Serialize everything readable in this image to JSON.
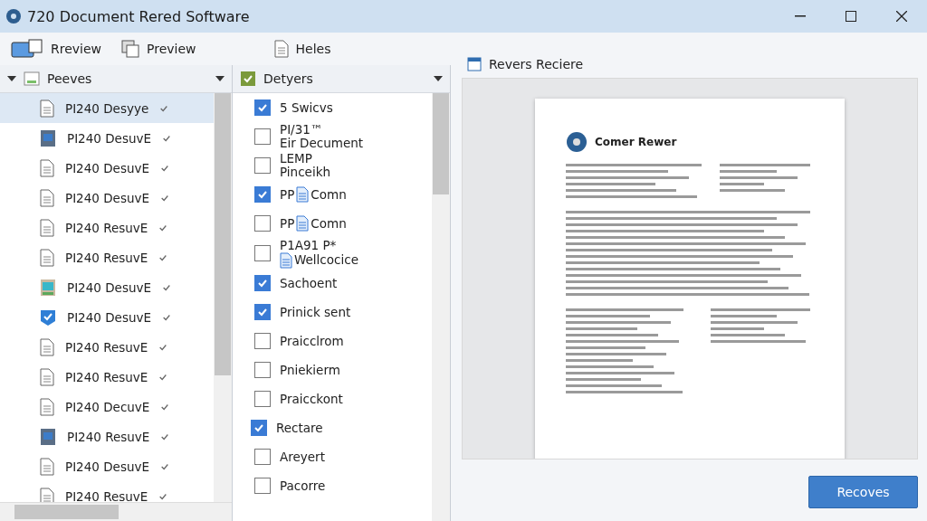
{
  "window": {
    "title": "720 Document Rered Software"
  },
  "toolbar": [
    {
      "label": "Rreview",
      "kind": "scanner"
    },
    {
      "label": "Preview",
      "kind": "windows"
    },
    {
      "label": "Heles",
      "kind": "document"
    }
  ],
  "files_panel": {
    "title": "Peeves",
    "items": [
      {
        "label": "PI240 Desyye",
        "kind": "document",
        "selected": true
      },
      {
        "label": "PI240 DesuvE",
        "kind": "app",
        "selected": false
      },
      {
        "label": "PI240 DesuvE",
        "kind": "document",
        "selected": false
      },
      {
        "label": "PI240 DesuvE",
        "kind": "document",
        "selected": false
      },
      {
        "label": "PI240 ResuvE",
        "kind": "document",
        "selected": false
      },
      {
        "label": "PI240 ResuvE",
        "kind": "document",
        "selected": false
      },
      {
        "label": "PI240 DesuvE",
        "kind": "image",
        "selected": false
      },
      {
        "label": "PI240 DesuvE",
        "kind": "check",
        "selected": false
      },
      {
        "label": "PI240 ResuvE",
        "kind": "document",
        "selected": false
      },
      {
        "label": "PI240 ResuvE",
        "kind": "document",
        "selected": false
      },
      {
        "label": "PI240 DecuvE",
        "kind": "document",
        "selected": false
      },
      {
        "label": "PI240 ResuvE",
        "kind": "app",
        "selected": false
      },
      {
        "label": "PI240 DesuvE",
        "kind": "document",
        "selected": false
      },
      {
        "label": "PI240 ResuvE",
        "kind": "document",
        "selected": false
      }
    ]
  },
  "types_panel": {
    "title": "Detyers",
    "items": [
      {
        "kind": "text",
        "label": "5 Swicvs",
        "checked": true
      },
      {
        "kind": "two_line",
        "label": "PI/31™",
        "sublabel": "Eir Decument",
        "checked": false
      },
      {
        "kind": "two_line",
        "label": "LEMP",
        "sublabel": "Pinceikh",
        "checked": false
      },
      {
        "kind": "icon",
        "label": "PP",
        "sublabel": "Comn",
        "checked": true
      },
      {
        "kind": "icon",
        "label": "PP",
        "sublabel": "Comn",
        "checked": false
      },
      {
        "kind": "two_line_icon",
        "label": "P1A91 P*",
        "sublabel": "Wellcocice",
        "checked": false
      },
      {
        "kind": "text",
        "label": "Sachoent",
        "checked": true
      },
      {
        "kind": "text",
        "label": "Prinick sent",
        "checked": true
      },
      {
        "kind": "text",
        "label": "Praicclrom",
        "checked": false
      },
      {
        "kind": "text",
        "label": "Pniekierm",
        "checked": false
      },
      {
        "kind": "text",
        "label": "Praicckont",
        "checked": false
      },
      {
        "kind": "outdent",
        "label": "Rectare",
        "checked": true
      },
      {
        "kind": "text",
        "label": "Areyert",
        "checked": false
      },
      {
        "kind": "text",
        "label": "Pacorre",
        "checked": false
      }
    ]
  },
  "preview": {
    "title": "Revers Reciere",
    "document_title": "Comer Rewer"
  },
  "buttons": [
    {
      "label": "Recoves"
    }
  ]
}
